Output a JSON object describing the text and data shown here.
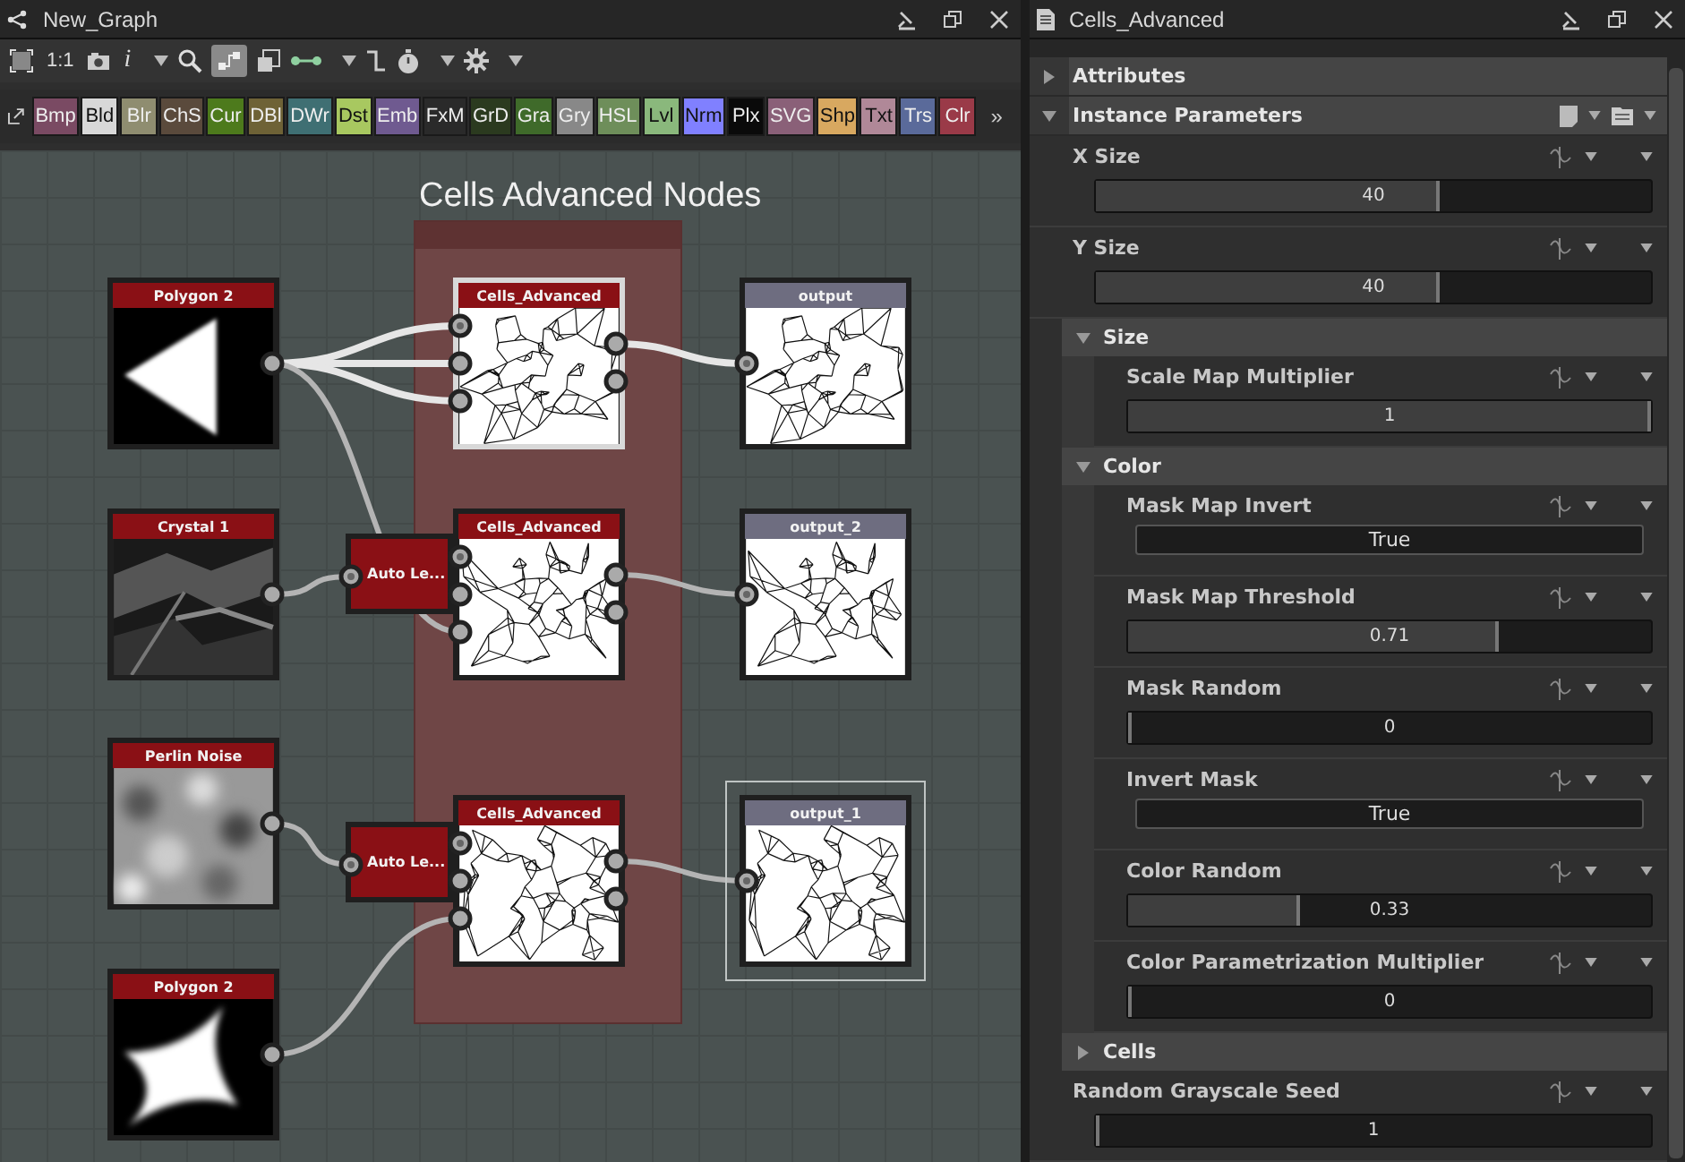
{
  "graph_panel": {
    "title": "New_Graph",
    "toolbar": {
      "zoom_label": "1:1",
      "info_label": "i",
      "link_mode_selected": true
    },
    "palette": {
      "chips": [
        {
          "label": "Bmp",
          "color": "#7a4a63"
        },
        {
          "label": "Bld",
          "color": "#d8d8d8"
        },
        {
          "label": "Blr",
          "color": "#8f8d70"
        },
        {
          "label": "ChS",
          "color": "#5a4a3c"
        },
        {
          "label": "Cur",
          "color": "#4d7a1c"
        },
        {
          "label": "DBl",
          "color": "#6e6236"
        },
        {
          "label": "DWr",
          "color": "#3f6f73"
        },
        {
          "label": "Dst",
          "color": "#a8c860"
        },
        {
          "label": "Emb",
          "color": "#6f5a90"
        },
        {
          "label": "FxM",
          "color": "#2a2a2a"
        },
        {
          "label": "GrD",
          "color": "#2b3a1f"
        },
        {
          "label": "Gra",
          "color": "#3f6a2a"
        },
        {
          "label": "Gry",
          "color": "#888888"
        },
        {
          "label": "HSL",
          "color": "#6e8e5a"
        },
        {
          "label": "Lvl",
          "color": "#8ab87c"
        },
        {
          "label": "Nrm",
          "color": "#8080ff"
        },
        {
          "label": "Plx",
          "color": "#0a0a0a"
        },
        {
          "label": "SVG",
          "color": "#8a6078"
        },
        {
          "label": "Shp",
          "color": "#d8a860"
        },
        {
          "label": "Txt",
          "color": "#b08898"
        },
        {
          "label": "Trs",
          "color": "#5a6a9a"
        },
        {
          "label": "Clr",
          "color": "#9a3a48"
        }
      ],
      "more": "»"
    },
    "frame": {
      "title": "Cells Advanced Nodes"
    },
    "nodes": [
      {
        "title": "Polygon 2",
        "kind": "source",
        "active": false,
        "selected": false
      },
      {
        "title": "Cells_Advanced",
        "kind": "filter",
        "active": true,
        "selected": false
      },
      {
        "title": "output",
        "kind": "output",
        "active": false,
        "selected": false
      },
      {
        "title": "Crystal 1",
        "kind": "source",
        "active": false,
        "selected": false
      },
      {
        "title": "Auto Le...",
        "kind": "compact",
        "active": false,
        "selected": false
      },
      {
        "title": "Cells_Advanced",
        "kind": "filter",
        "active": false,
        "selected": false
      },
      {
        "title": "output_2",
        "kind": "output",
        "active": false,
        "selected": false
      },
      {
        "title": "Perlin Noise",
        "kind": "source",
        "active": false,
        "selected": false
      },
      {
        "title": "Auto Le...",
        "kind": "compact",
        "active": false,
        "selected": false
      },
      {
        "title": "Cells_Advanced",
        "kind": "filter",
        "active": false,
        "selected": false
      },
      {
        "title": "output_1",
        "kind": "output",
        "active": false,
        "selected": true
      },
      {
        "title": "Polygon 2",
        "kind": "source",
        "active": false,
        "selected": false
      }
    ]
  },
  "properties_panel": {
    "title": "Cells_Advanced",
    "items": [
      {
        "kind": "section",
        "label": "Attributes",
        "expanded": false,
        "preset_menu": false
      },
      {
        "kind": "section",
        "label": "Instance Parameters",
        "expanded": true,
        "preset_menu": true,
        "children": [
          {
            "kind": "slider",
            "label": "X Size",
            "value": "40",
            "level": 0.62
          },
          {
            "kind": "slider",
            "label": "Y Size",
            "value": "40",
            "level": 0.62
          },
          {
            "kind": "group",
            "label": "Size",
            "expanded": true,
            "children": [
              {
                "kind": "slider",
                "label": "Scale Map Multiplier",
                "value": "1",
                "level": 1
              }
            ]
          },
          {
            "kind": "group",
            "label": "Color",
            "expanded": true,
            "children": [
              {
                "kind": "toggle",
                "label": "Mask Map Invert",
                "value": "True"
              },
              {
                "kind": "slider",
                "label": "Mask Map Threshold",
                "value": "0.71",
                "level": 0.71
              },
              {
                "kind": "slider",
                "label": "Mask Random",
                "value": "0",
                "level": 0
              },
              {
                "kind": "toggle",
                "label": "Invert Mask",
                "value": "True"
              },
              {
                "kind": "slider",
                "label": "Color Random",
                "value": "0.33",
                "level": 0.33
              },
              {
                "kind": "slider",
                "label": "Color Parametrization Multiplier",
                "value": "0",
                "level": 0
              }
            ]
          },
          {
            "kind": "group",
            "label": "Cells",
            "expanded": false
          },
          {
            "kind": "slider",
            "label": "Random Grayscale Seed",
            "value": "1",
            "level": 0
          }
        ]
      }
    ]
  }
}
